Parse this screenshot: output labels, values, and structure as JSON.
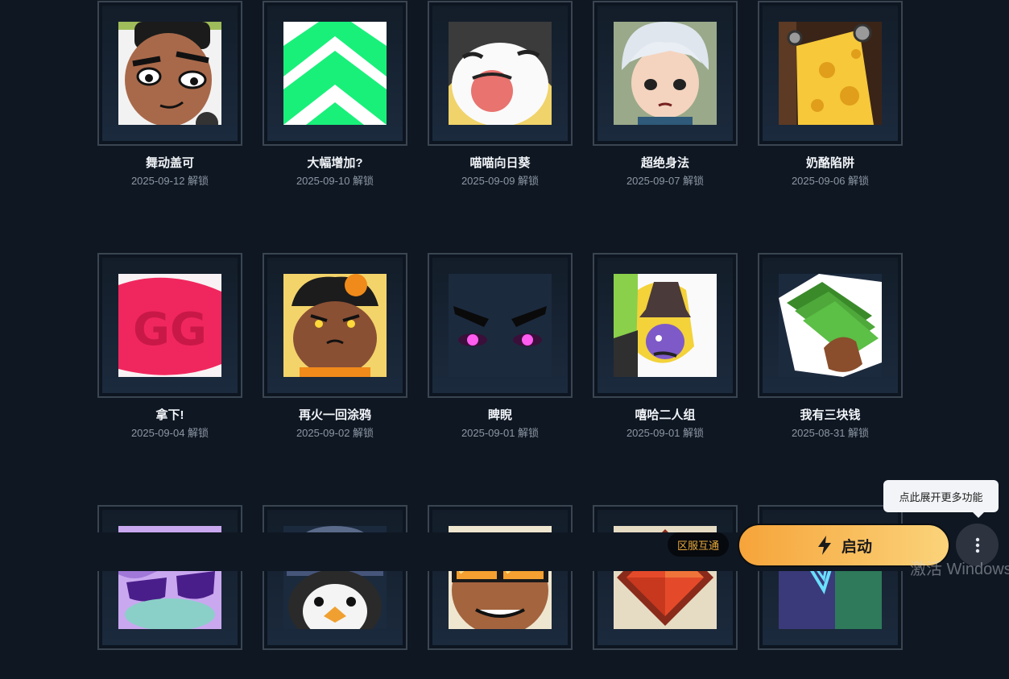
{
  "items": [
    {
      "name": "舞动盖可",
      "date": "2025-09-12 解锁",
      "icon": "dancing-man-icon"
    },
    {
      "name": "大幅增加?",
      "date": "2025-09-10 解锁",
      "icon": "green-chevron-icon"
    },
    {
      "name": "喵喵向日葵",
      "date": "2025-09-09 解锁",
      "icon": "laughing-cat-icon"
    },
    {
      "name": "超绝身法",
      "date": "2025-09-07 解锁",
      "icon": "silver-hair-character-icon"
    },
    {
      "name": "奶酪陷阱",
      "date": "2025-09-06 解锁",
      "icon": "cheese-trap-icon"
    },
    {
      "name": "拿下!",
      "date": "2025-09-04 解锁",
      "icon": "gg-stamp-icon"
    },
    {
      "name": "再火一回涂鸦",
      "date": "2025-09-02 解锁",
      "icon": "flower-hair-character-icon"
    },
    {
      "name": "睥睨",
      "date": "2025-09-01 解锁",
      "icon": "glowing-eyes-icon"
    },
    {
      "name": "嘻哈二人组",
      "date": "2025-09-01 解锁",
      "icon": "cowboy-hat-duo-icon"
    },
    {
      "name": "我有三块钱",
      "date": "2025-08-31 解锁",
      "icon": "money-hand-icon"
    },
    {
      "name": "",
      "date": "",
      "icon": "sunglasses-swirl-icon"
    },
    {
      "name": "",
      "date": "",
      "icon": "penguin-beanie-icon"
    },
    {
      "name": "",
      "date": "",
      "icon": "cool-sunglasses-character-icon"
    },
    {
      "name": "",
      "date": "",
      "icon": "red-diamond-icon"
    },
    {
      "name": "",
      "date": "",
      "icon": "valorant-logo-tag-icon"
    }
  ],
  "badge": "区服互通",
  "launch_label": "启动",
  "tooltip": "点此展开更多功能",
  "watermark": "激活 Windows",
  "colors": {
    "accent_start": "#f6a43a",
    "accent_end": "#fbd37a",
    "background": "#0f1722",
    "badge_text": "#e8a83a"
  }
}
